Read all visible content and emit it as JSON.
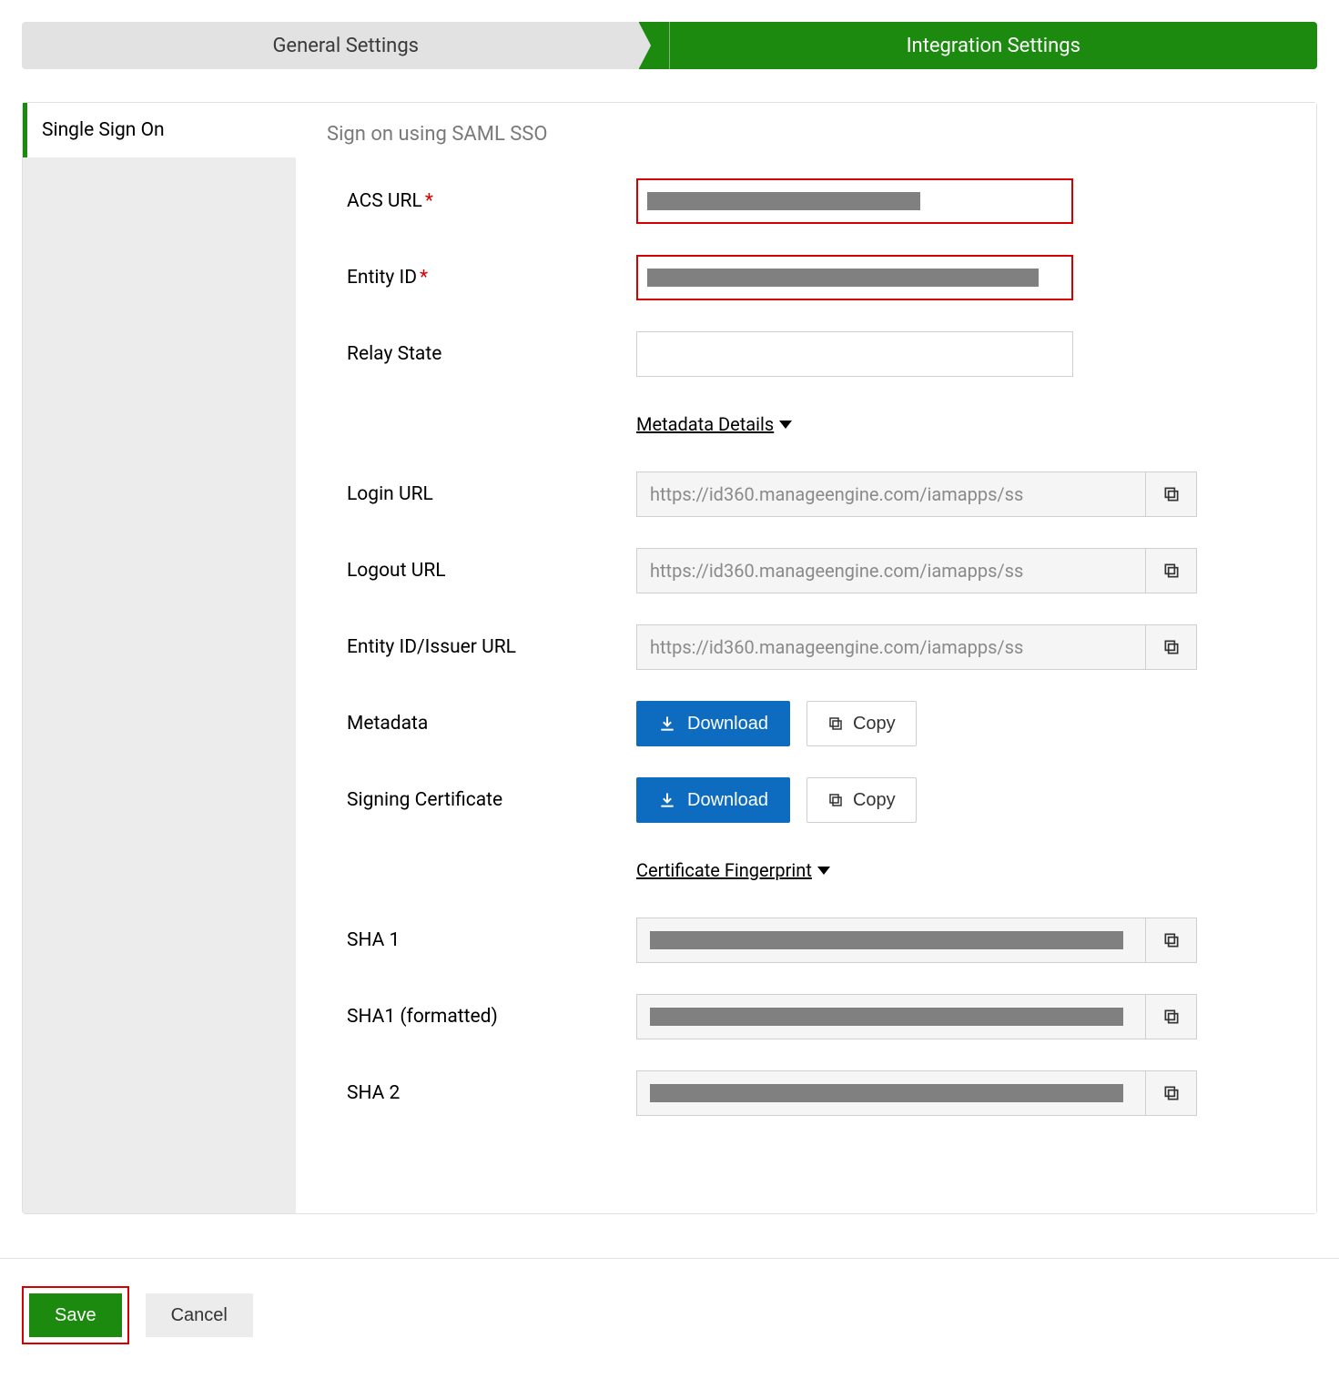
{
  "tabs": {
    "general": "General Settings",
    "integration": "Integration Settings"
  },
  "sidebar": {
    "items": [
      {
        "label": "Single Sign On"
      }
    ]
  },
  "section_title": "Sign on using SAML SSO",
  "fields": {
    "acs_url_label": "ACS URL",
    "entity_id_label": "Entity ID",
    "relay_state_label": "Relay State",
    "login_url_label": "Login URL",
    "logout_url_label": "Logout URL",
    "entity_issuer_label": "Entity ID/Issuer URL",
    "metadata_label": "Metadata",
    "signing_cert_label": "Signing Certificate",
    "sha1_label": "SHA 1",
    "sha1f_label": "SHA1 (formatted)",
    "sha2_label": "SHA 2"
  },
  "readonly_values": {
    "login_url": "https://id360.manageengine.com/iamapps/ss",
    "logout_url": "https://id360.manageengine.com/iamapps/ss",
    "entity_issuer": "https://id360.manageengine.com/iamapps/ss"
  },
  "headings": {
    "metadata_details": "Metadata Details ",
    "cert_fingerprint": "Certificate Fingerprint "
  },
  "buttons": {
    "download": "Download",
    "copy": "Copy",
    "save": "Save",
    "cancel": "Cancel"
  }
}
